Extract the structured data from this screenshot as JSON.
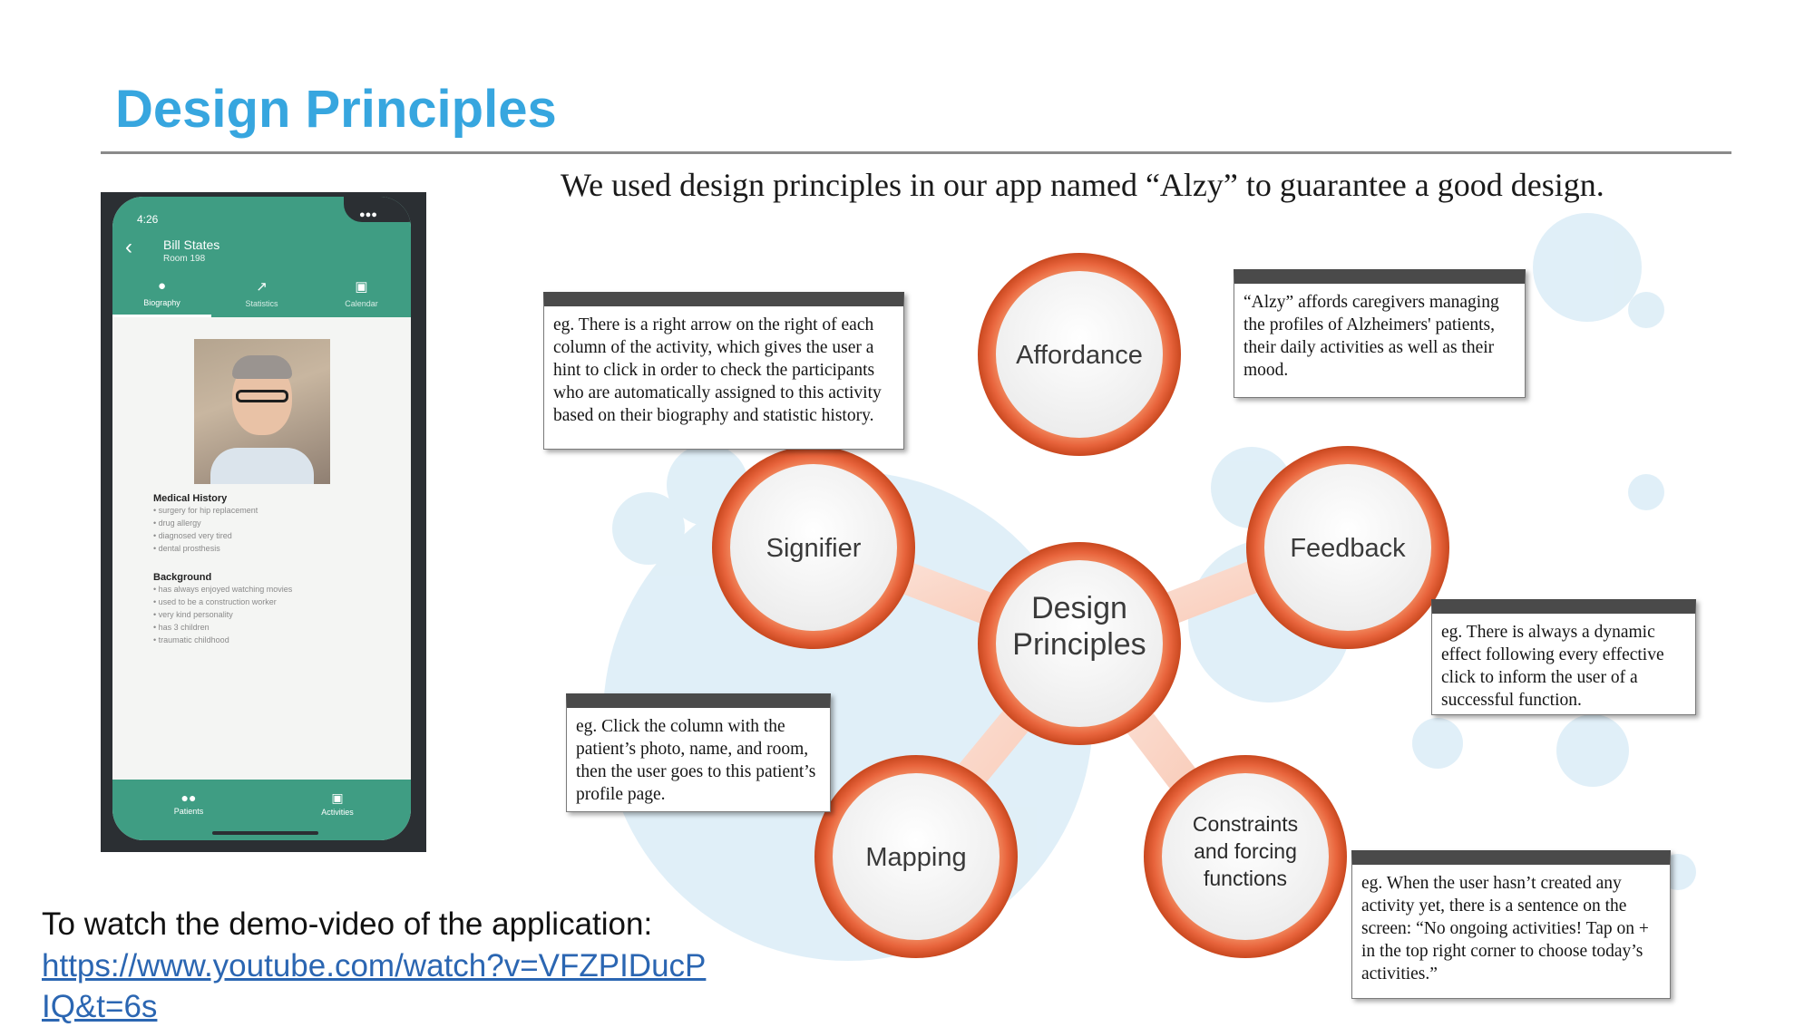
{
  "slide": {
    "title": "Design Principles",
    "intro": "We used design principles in our app named “Alzy” to guarantee a good design."
  },
  "phone": {
    "time": "4:26",
    "patient_name": "Bill States",
    "room": "Room 198",
    "tabs": [
      {
        "label": "Biography",
        "icon": "person-icon"
      },
      {
        "label": "Statistics",
        "icon": "chart-icon"
      },
      {
        "label": "Calendar",
        "icon": "calendar-icon"
      }
    ],
    "medical_history_title": "Medical History",
    "medical_history": [
      "• surgery for hip replacement",
      "• drug allergy",
      "• diagnosed very tired",
      "• dental prosthesis"
    ],
    "background_title": "Background",
    "background": [
      "• has always enjoyed watching movies",
      "• used to be a construction worker",
      "• very kind personality",
      "• has 3 children",
      "• traumatic childhood"
    ],
    "nav": [
      {
        "label": "Patients",
        "icon": "people-icon"
      },
      {
        "label": "Activities",
        "icon": "calendar-icon"
      }
    ],
    "accent_color": "#3f9d83"
  },
  "demo": {
    "label": "To watch the demo-video of the application:",
    "url": "https://www.youtube.com/watch?v=VFZPIDucPIQ&t=6s"
  },
  "diagram": {
    "center": [
      "Design",
      "Principles"
    ],
    "nodes": {
      "affordance": "Affordance",
      "signifier": "Signifier",
      "feedback": "Feedback",
      "mapping": "Mapping",
      "constraints": [
        "Constraints",
        "and forcing",
        "functions"
      ]
    },
    "callouts": {
      "signifier": "eg. There is a right arrow on the right of each column of the activity, which gives the user a hint to click in order to check the participants who are automatically assigned to this activity based on their biography and statistic history.",
      "affordance": "“Alzy” affords caregivers managing the profiles of Alzheimers' patients, their daily activities as well as their mood.",
      "feedback": "eg. There is always a dynamic effect following every effective click to inform the user of a successful function.",
      "mapping": "eg. Click the column with the patient’s photo, name, and room, then the user goes to this patient’s profile page.",
      "constraints": "eg. When the user hasn’t created any activity yet, there is a sentence on the screen: “No ongoing activities! Tap on + in the top right corner to choose today’s activities.”"
    },
    "ring_color": "#e8643c",
    "bubble_color": "#cfe6f3"
  }
}
